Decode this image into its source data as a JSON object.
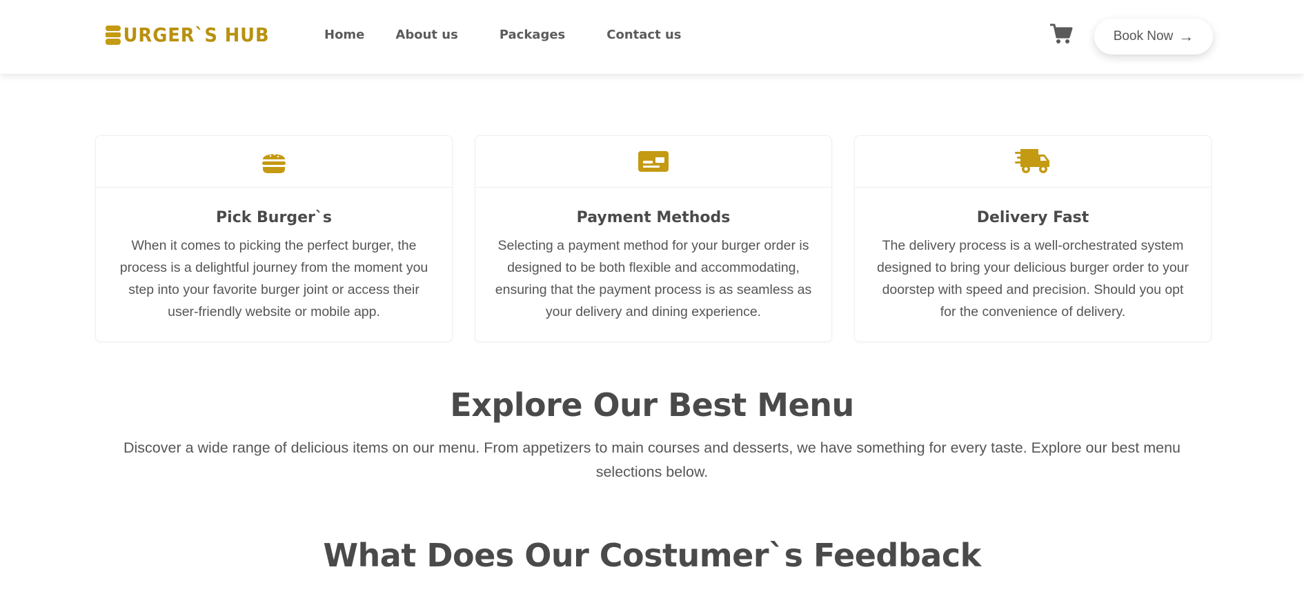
{
  "header": {
    "logo_text": "URGER`S HUB",
    "nav": [
      "Home",
      "About us",
      "Packages",
      "Contact us"
    ],
    "cart_icon": "cart-icon",
    "book_label": "Book Now",
    "book_icon": "arrow-right-icon"
  },
  "colors": {
    "brand": "#c49a12",
    "text": "#4a4a4a",
    "muted": "#555555"
  },
  "features": [
    {
      "icon": "burger-icon",
      "title": "Pick Burger`s",
      "text": "When it comes to picking the perfect burger, the process is a delightful journey from the moment you step into your favorite burger joint or access their user-friendly website or mobile app."
    },
    {
      "icon": "credit-card-icon",
      "title": "Payment Methods",
      "text": "Selecting a payment method for your burger order is designed to be both flexible and accommodating, ensuring that the payment process is as seamless as your delivery and dining experience."
    },
    {
      "icon": "delivery-truck-icon",
      "title": "Delivery Fast",
      "text": "The delivery process is a well-orchestrated system designed to bring your delicious burger order to your doorstep with speed and precision. Should you opt for the convenience of delivery."
    }
  ],
  "menu_section": {
    "title": "Explore Our Best Menu",
    "text": "Discover a wide range of delicious items on our menu. From appetizers to main courses and desserts, we have something for every taste. Explore our best menu selections below."
  },
  "feedback_section": {
    "title": "What Does Our Costumer`s Feedback"
  }
}
